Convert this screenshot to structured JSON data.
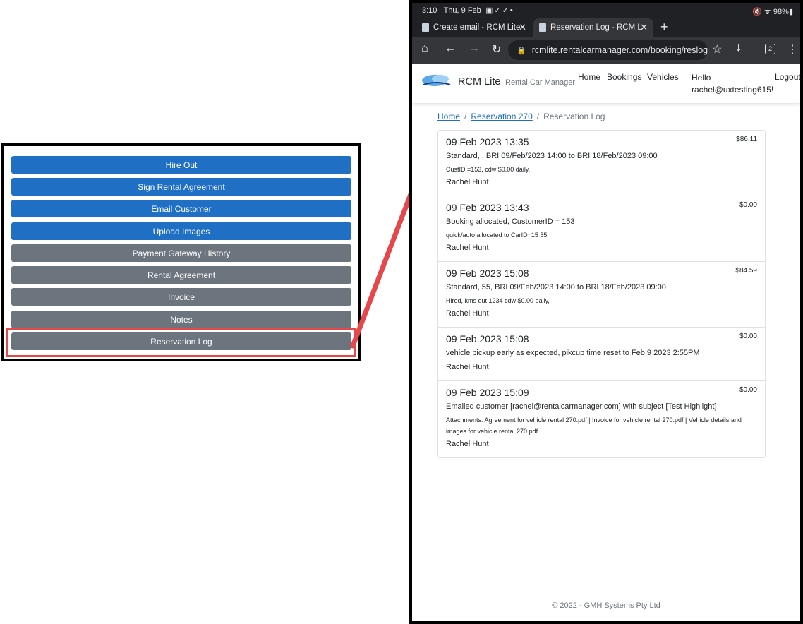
{
  "callout": {
    "buttons": [
      {
        "label": "Hire Out",
        "color": "#1f6fc5"
      },
      {
        "label": "Sign Rental Agreement",
        "color": "#1f6fc5"
      },
      {
        "label": "Email Customer",
        "color": "#1f6fc5"
      },
      {
        "label": "Upload Images",
        "color": "#1f6fc5"
      },
      {
        "label": "Payment Gateway History",
        "color": "#6c757d"
      },
      {
        "label": "Rental Agreement",
        "color": "#6c757d"
      },
      {
        "label": "Invoice",
        "color": "#6c757d"
      },
      {
        "label": "Notes",
        "color": "#6c757d"
      },
      {
        "label": "Reservation Log",
        "color": "#6c757d"
      }
    ],
    "highlight_color": "#e5474b"
  },
  "statusbar": {
    "time": "3:10",
    "date": "Thu, 9 Feb",
    "battery": "98%"
  },
  "browser": {
    "tabs": [
      {
        "label": "Create email - RCM Lite"
      },
      {
        "label": "Reservation Log - RCM Lite"
      }
    ],
    "url": "rcmlite.rentalcarmanager.com/booking/reslog",
    "tab_count": "2"
  },
  "site": {
    "logo_text": "Rental Car Manager",
    "brand": "RCM Lite",
    "brand_sub": "Rental Car Manager",
    "nav": [
      "Home",
      "Bookings",
      "Vehicles"
    ],
    "hello": "Hello",
    "user_email": "rachel@uxtesting615!",
    "logout": "Logout"
  },
  "breadcrumb": {
    "home": "Home",
    "reservation": "Reservation 270",
    "current": "Reservation Log"
  },
  "log_entries": [
    {
      "date": "09 Feb 2023 13:35",
      "amount": "$86.11",
      "desc": "Standard, , BRI 09/Feb/2023 14:00 to BRI 18/Feb/2023 09:00",
      "detail": "CustID =153, cdw $0.00 daily,",
      "user": "Rachel Hunt"
    },
    {
      "date": "09 Feb 2023 13:43",
      "amount": "$0.00",
      "desc": "Booking allocated, CustomerID = 153",
      "detail": "quick/auto allocated to CarID=15 55",
      "user": "Rachel Hunt"
    },
    {
      "date": "09 Feb 2023 15:08",
      "amount": "$84.59",
      "desc": "Standard, 55, BRI 09/Feb/2023 14:00 to BRI 18/Feb/2023 09:00",
      "detail": "Hired, kms out 1234 cdw $0.00 daily,",
      "user": "Rachel Hunt"
    },
    {
      "date": "09 Feb 2023 15:08",
      "amount": "$0.00",
      "desc": "vehicle pickup early as expected, pikcup time reset to Feb 9 2023 2:55PM",
      "detail": "",
      "user": "Rachel Hunt"
    },
    {
      "date": "09 Feb 2023 15:09",
      "amount": "$0.00",
      "desc": "Emailed customer [rachel@rentalcarmanager.com] with subject [Test Highlight]",
      "detail": "Attachments: Agreement for vehicle rental 270.pdf | Invoice for vehicle rental 270.pdf | Vehicle details and images for vehicle rental 270.pdf",
      "user": "Rachel Hunt"
    }
  ],
  "footer": "© 2022 - GMH Systems Pty Ltd"
}
